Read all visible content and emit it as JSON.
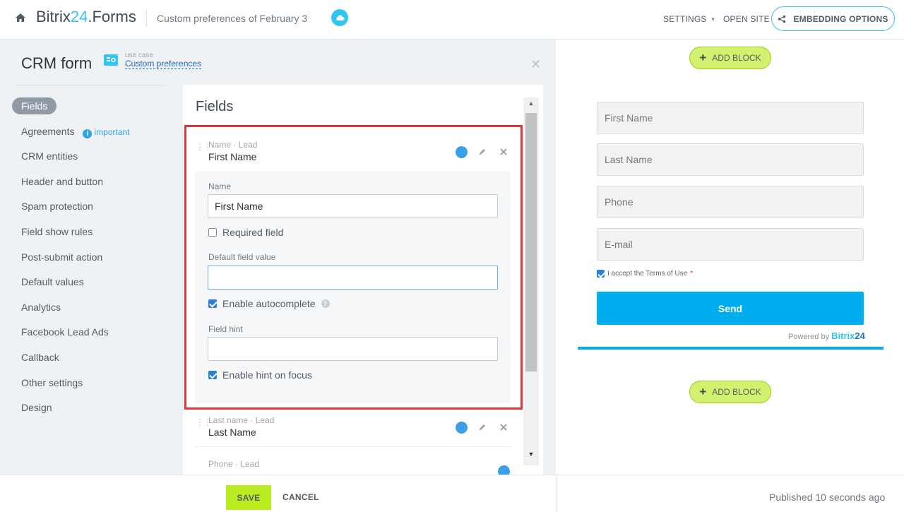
{
  "header": {
    "brand_name": "Bitrix",
    "brand_num": "24",
    "brand_suffix": ".Forms",
    "form_title": "Custom preferences of February 3",
    "settings_label": "SETTINGS",
    "open_site_label": "OPEN SITE",
    "embed_label": "EMBEDDING OPTIONS"
  },
  "panel": {
    "title": "CRM form",
    "use_case_small": "use case",
    "use_case_link": "Custom preferences",
    "menu": [
      {
        "label": "Fields",
        "active": true
      },
      {
        "label": "Agreements",
        "badge": "important"
      },
      {
        "label": "CRM entities"
      },
      {
        "label": "Header and button"
      },
      {
        "label": "Spam protection"
      },
      {
        "label": "Field show rules"
      },
      {
        "label": "Post-submit action"
      },
      {
        "label": "Default values"
      },
      {
        "label": "Analytics"
      },
      {
        "label": "Facebook Lead Ads"
      },
      {
        "label": "Callback"
      },
      {
        "label": "Other settings"
      },
      {
        "label": "Design"
      }
    ]
  },
  "fields": {
    "heading": "Fields",
    "items": [
      {
        "sub": "Name · Lead",
        "name": "First Name"
      },
      {
        "sub": "Last name · Lead",
        "name": "Last Name"
      },
      {
        "sub": "Phone · Lead",
        "name": ""
      }
    ],
    "editor": {
      "name_label": "Name",
      "name_value": "First Name",
      "required_label": "Required field",
      "required_checked": false,
      "default_label": "Default field value",
      "default_value": "",
      "autocomplete_label": "Enable autocomplete",
      "autocomplete_checked": true,
      "hint_label": "Field hint",
      "hint_value": "",
      "hint_focus_label": "Enable hint on focus",
      "hint_focus_checked": true
    }
  },
  "footer": {
    "save_label": "SAVE",
    "cancel_label": "CANCEL",
    "published": "Published 10 seconds ago"
  },
  "preview": {
    "add_block_label": "ADD BLOCK",
    "inputs": [
      "First Name",
      "Last Name",
      "Phone",
      "E-mail"
    ],
    "terms_label": "I accept the Terms of Use",
    "terms_star": "*",
    "send_label": "Send",
    "powered_by": "Powered by",
    "powered_brand": "Bitrix",
    "powered_num": "24"
  },
  "colors": {
    "accent": "#2fc6f6",
    "save": "#bbed21",
    "send": "#00aeef",
    "highlight": "#e4343a"
  }
}
